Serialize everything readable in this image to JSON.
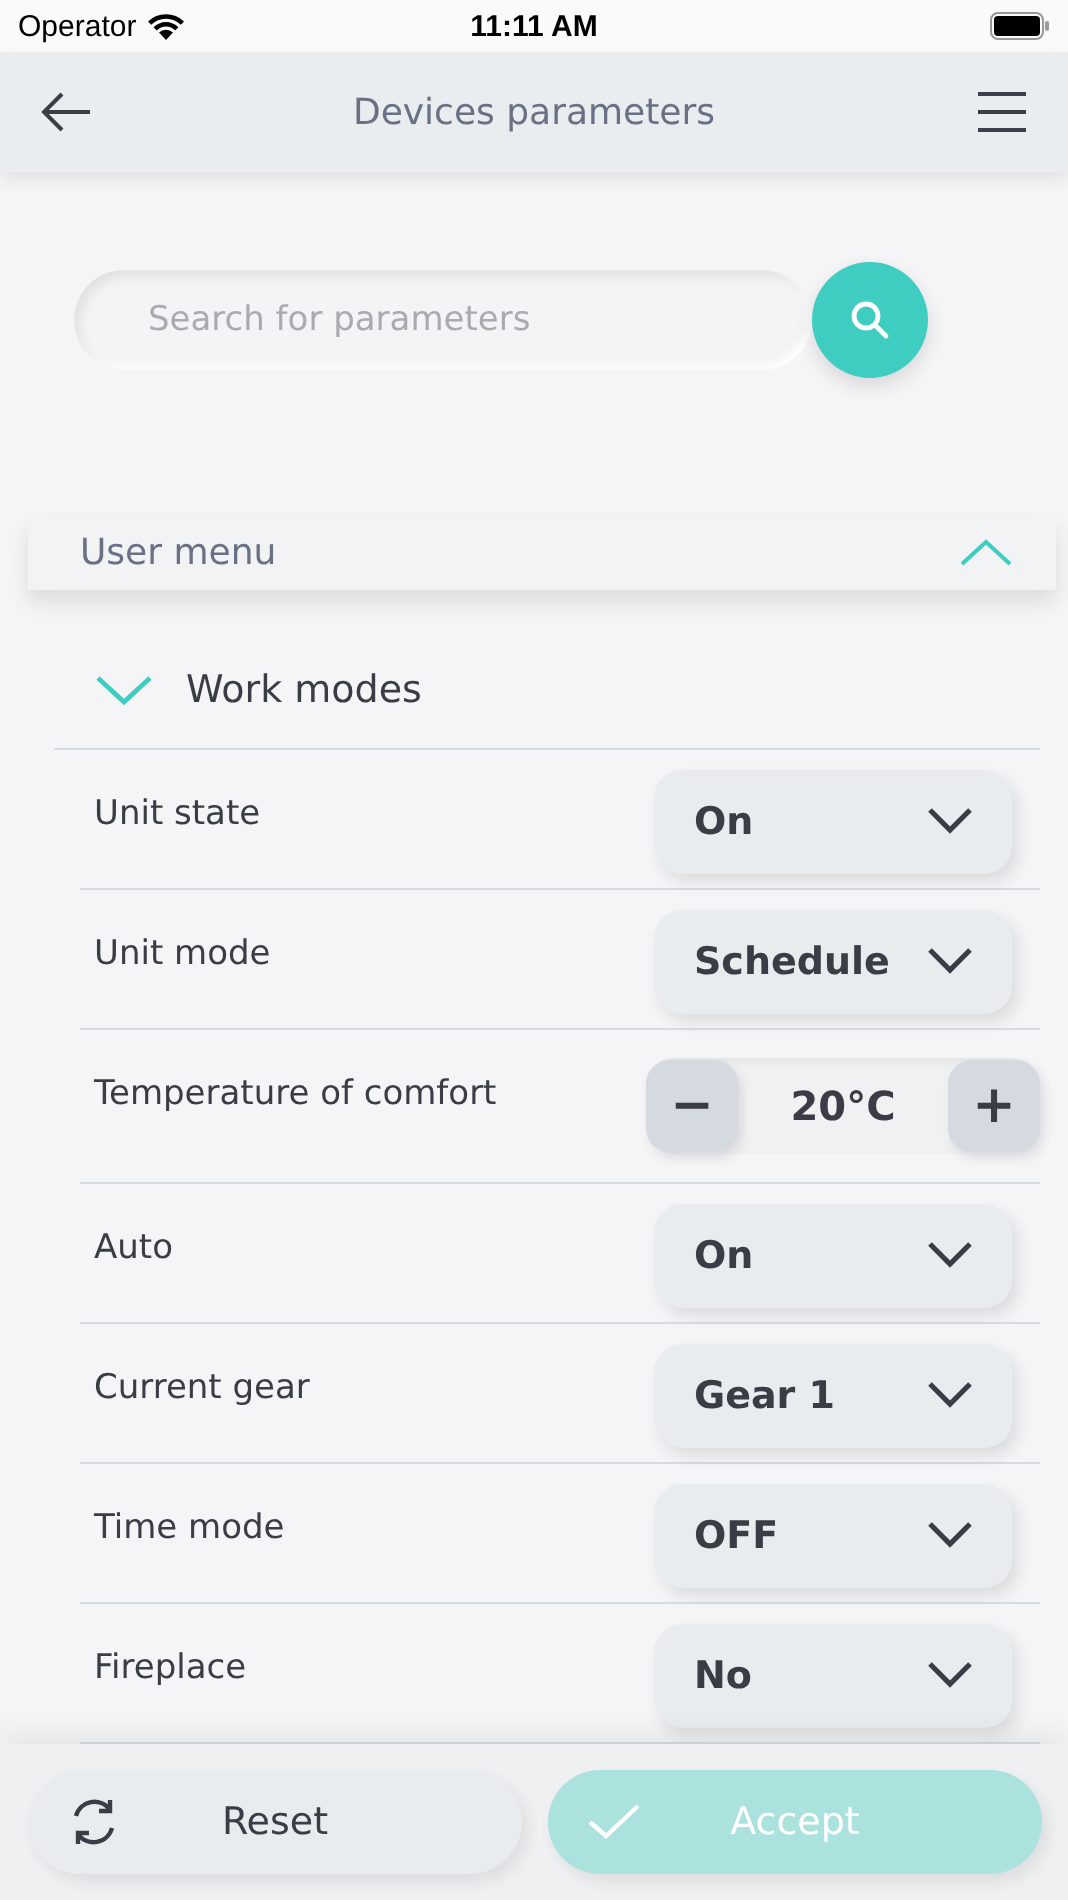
{
  "status_bar": {
    "carrier": "Operator",
    "time": "11:11 AM"
  },
  "header": {
    "title": "Devices parameters"
  },
  "search": {
    "placeholder": "Search for parameters"
  },
  "section": {
    "title": "User menu",
    "expanded": true,
    "group": {
      "title": "Work modes",
      "expanded": true,
      "parameters": [
        {
          "kind": "select",
          "label": "Unit state",
          "value": "On"
        },
        {
          "kind": "select",
          "label": "Unit mode",
          "value": "Schedule"
        },
        {
          "kind": "stepper",
          "label": "Temperature of comfort",
          "value": "20°C",
          "minus": "−",
          "plus": "+"
        },
        {
          "kind": "select",
          "label": "Auto",
          "value": "On"
        },
        {
          "kind": "select",
          "label": "Current gear",
          "value": "Gear 1"
        },
        {
          "kind": "select",
          "label": "Time mode",
          "value": "OFF"
        },
        {
          "kind": "select",
          "label": "Fireplace",
          "value": "No"
        }
      ]
    }
  },
  "actions": [
    {
      "kind": "reset",
      "label": "Reset",
      "disabled": false
    },
    {
      "kind": "accept",
      "label": "Accept",
      "disabled": true
    }
  ]
}
